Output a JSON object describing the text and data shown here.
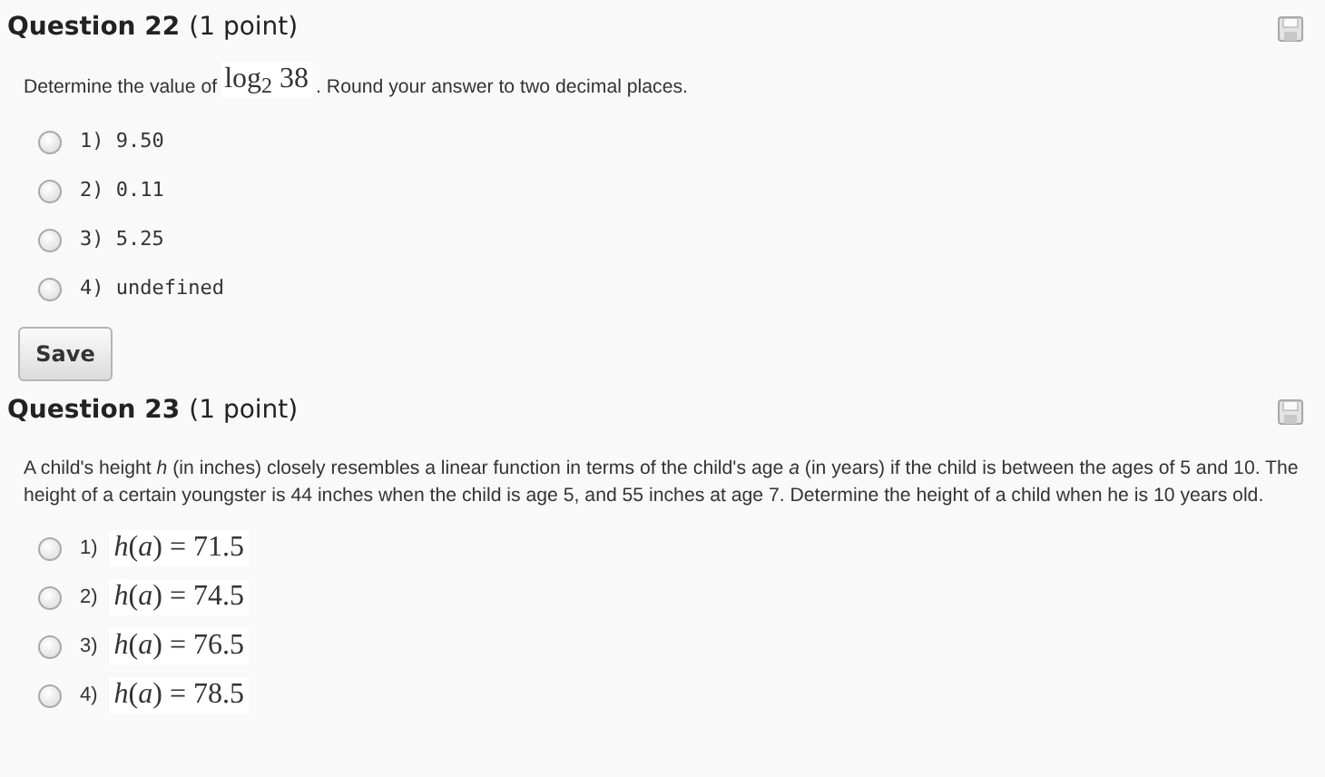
{
  "questions": [
    {
      "title": "Question 22",
      "points": "(1 point)",
      "prompt": [
        {
          "kind": "text",
          "text": "Determine the value of"
        },
        {
          "kind": "math",
          "text": "log$_{2}$ 38"
        },
        {
          "kind": "text",
          "text": ". Round your answer to two decimal places."
        }
      ],
      "options": [
        {
          "kind": "plain",
          "number": "1)",
          "text": "9.50",
          "selected": false
        },
        {
          "kind": "plain",
          "number": "2)",
          "text": "0.11",
          "selected": false
        },
        {
          "kind": "plain",
          "number": "3)",
          "text": "5.25",
          "selected": false
        },
        {
          "kind": "plain",
          "number": "4)",
          "text": "undefined",
          "selected": false
        }
      ],
      "save_button": "Save"
    },
    {
      "title": "Question 23",
      "points": "(1 point)",
      "prompt": [
        {
          "kind": "text",
          "text": "A child's height *h* (in inches) closely resembles a linear function in terms of the child's age *a* (in years) if the child is between the ages of 5 and 10. The height of a certain youngster is 44 inches when the child is age 5, and 55 inches at age 7. Determine the height of a child when he is 10 years old."
        }
      ],
      "options": [
        {
          "kind": "math",
          "number": "1)",
          "text": "*h*(*a*) = 71.5",
          "selected": false
        },
        {
          "kind": "math",
          "number": "2)",
          "text": "*h*(*a*) = 74.5",
          "selected": false
        },
        {
          "kind": "math",
          "number": "3)",
          "text": "*h*(*a*) = 76.5",
          "selected": false
        },
        {
          "kind": "math",
          "number": "4)",
          "text": "*h*(*a*) = 78.5",
          "selected": false
        }
      ]
    }
  ]
}
